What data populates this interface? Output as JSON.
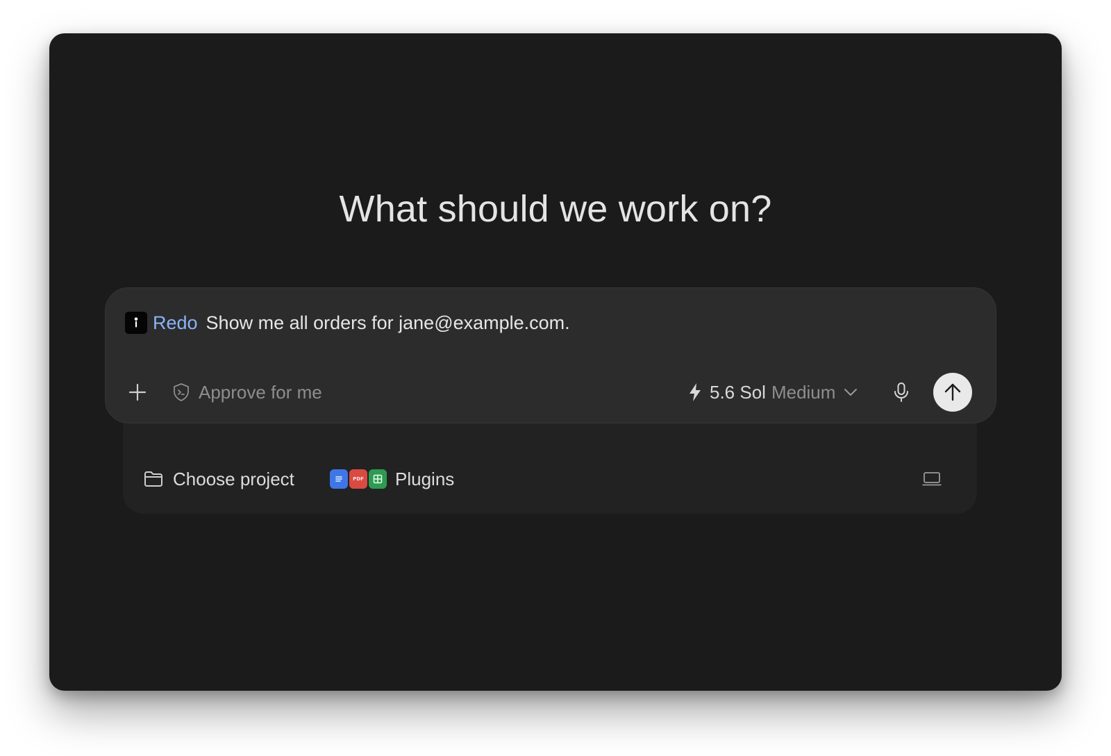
{
  "heading": "What should we work on?",
  "composer": {
    "app_name": "Redo",
    "prompt_text": "Show me all orders for jane@example.com.",
    "approve_label": "Approve for me",
    "model_version": "5.6 Sol",
    "model_effort": "Medium"
  },
  "footer": {
    "project_label": "Choose project",
    "plugins_label": "Plugins",
    "plugin_badge_text": "PDF"
  },
  "colors": {
    "window_bg": "#1b1b1b",
    "composer_bg": "#2c2c2c",
    "app_name_accent": "#8ab4f8",
    "send_button_bg": "#e9e9e9"
  },
  "icons": [
    "app-logo-icon",
    "plus-icon",
    "shield-icon",
    "lightning-icon",
    "chevron-down-icon",
    "microphone-icon",
    "arrow-up-icon",
    "folder-icon",
    "docs-icon",
    "pdf-icon",
    "sheets-icon",
    "laptop-icon"
  ]
}
